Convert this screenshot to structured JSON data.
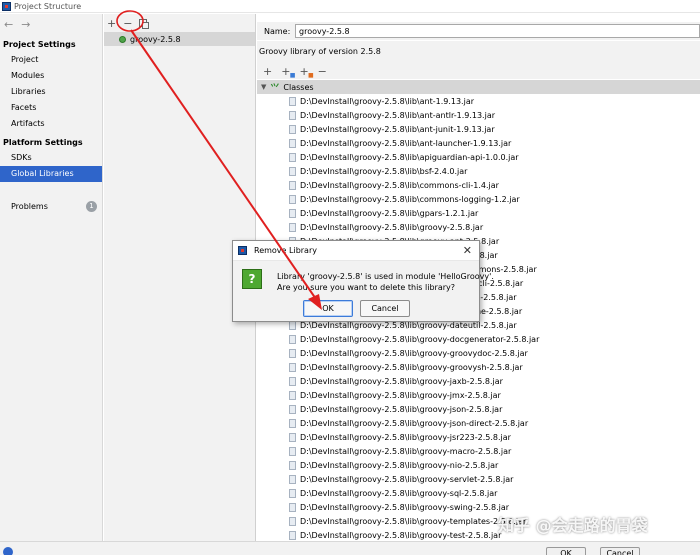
{
  "window": {
    "title": "Project Structure"
  },
  "nav": {
    "back": "←",
    "forward": "→",
    "project_settings_title": "Project Settings",
    "project_settings": [
      "Project",
      "Modules",
      "Libraries",
      "Facets",
      "Artifacts"
    ],
    "platform_settings_title": "Platform Settings",
    "platform_settings": [
      "SDKs",
      "Global Libraries"
    ],
    "selected": "Global Libraries",
    "problems_label": "Problems",
    "problems_count": "1"
  },
  "libraries": {
    "toolbar": {
      "add": "+",
      "remove": "−"
    },
    "items": [
      "groovy-2.5.8"
    ]
  },
  "detail": {
    "name_label": "Name:",
    "name_value": "groovy-2.5.8",
    "description": "Groovy library of version 2.5.8",
    "toolbar": {
      "add": "+",
      "add_sub": "+",
      "remove": "−"
    },
    "classes_label": "Classes",
    "jars": [
      "D:\\DevInstall\\groovy-2.5.8\\lib\\ant-1.9.13.jar",
      "D:\\DevInstall\\groovy-2.5.8\\lib\\ant-antlr-1.9.13.jar",
      "D:\\DevInstall\\groovy-2.5.8\\lib\\ant-junit-1.9.13.jar",
      "D:\\DevInstall\\groovy-2.5.8\\lib\\ant-launcher-1.9.13.jar",
      "D:\\DevInstall\\groovy-2.5.8\\lib\\apiguardian-api-1.0.0.jar",
      "D:\\DevInstall\\groovy-2.5.8\\lib\\bsf-2.4.0.jar",
      "D:\\DevInstall\\groovy-2.5.8\\lib\\commons-cli-1.4.jar",
      "D:\\DevInstall\\groovy-2.5.8\\lib\\commons-logging-1.2.jar",
      "D:\\DevInstall\\groovy-2.5.8\\lib\\gpars-1.2.1.jar",
      "D:\\DevInstall\\groovy-2.5.8\\lib\\groovy-2.5.8.jar",
      "D:\\DevInstall\\groovy-2.5.8\\lib\\groovy-ant-2.5.8.jar",
      "D:\\DevInstall\\groovy-2.5.8\\lib\\groovy-bsf-2.5.8.jar",
      "D:\\DevInstall\\groovy-2.5.8\\lib\\groovy-cli-commons-2.5.8.jar",
      "D:\\DevInstall\\groovy-2.5.8\\lib\\groovy-cli-picocli-2.5.8.jar",
      "D:\\DevInstall\\groovy-2.5.8\\lib\\groovy-console-2.5.8.jar",
      "D:\\DevInstall\\groovy-2.5.8\\lib\\groovy-datetime-2.5.8.jar",
      "D:\\DevInstall\\groovy-2.5.8\\lib\\groovy-dateutil-2.5.8.jar",
      "D:\\DevInstall\\groovy-2.5.8\\lib\\groovy-docgenerator-2.5.8.jar",
      "D:\\DevInstall\\groovy-2.5.8\\lib\\groovy-groovydoc-2.5.8.jar",
      "D:\\DevInstall\\groovy-2.5.8\\lib\\groovy-groovysh-2.5.8.jar",
      "D:\\DevInstall\\groovy-2.5.8\\lib\\groovy-jaxb-2.5.8.jar",
      "D:\\DevInstall\\groovy-2.5.8\\lib\\groovy-jmx-2.5.8.jar",
      "D:\\DevInstall\\groovy-2.5.8\\lib\\groovy-json-2.5.8.jar",
      "D:\\DevInstall\\groovy-2.5.8\\lib\\groovy-json-direct-2.5.8.jar",
      "D:\\DevInstall\\groovy-2.5.8\\lib\\groovy-jsr223-2.5.8.jar",
      "D:\\DevInstall\\groovy-2.5.8\\lib\\groovy-macro-2.5.8.jar",
      "D:\\DevInstall\\groovy-2.5.8\\lib\\groovy-nio-2.5.8.jar",
      "D:\\DevInstall\\groovy-2.5.8\\lib\\groovy-servlet-2.5.8.jar",
      "D:\\DevInstall\\groovy-2.5.8\\lib\\groovy-sql-2.5.8.jar",
      "D:\\DevInstall\\groovy-2.5.8\\lib\\groovy-swing-2.5.8.jar",
      "D:\\DevInstall\\groovy-2.5.8\\lib\\groovy-templates-2.5.8.jar",
      "D:\\DevInstall\\groovy-2.5.8\\lib\\groovy-test-2.5.8.jar"
    ]
  },
  "dialog": {
    "title": "Remove Library",
    "close": "✕",
    "icon": "?",
    "message_line1": "Library 'groovy-2.5.8' is used in module 'HelloGroovy'.",
    "message_line2": "Are you sure you want to delete this library?",
    "ok": "OK",
    "cancel": "Cancel"
  },
  "footer": {
    "ok": "OK",
    "cancel": "Cancel"
  },
  "watermark": "知乎 @会走路的胃袋",
  "colors": {
    "selection": "#2f65ca",
    "annotation": "#e02020",
    "question_icon": "#4ea831"
  }
}
